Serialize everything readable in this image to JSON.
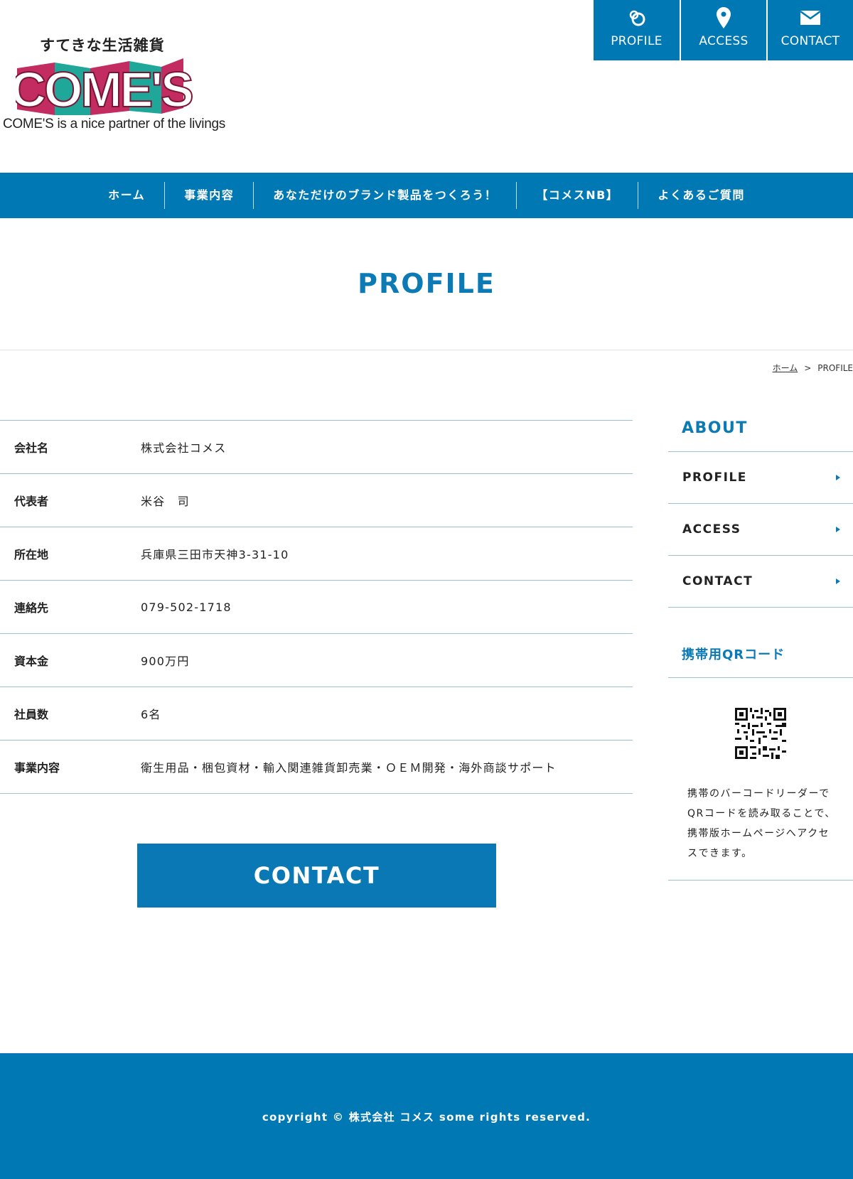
{
  "logo": {
    "tagline_jp": "すてきな生活雑貨",
    "brand": "COME'S",
    "subtitle": "COME'S is a nice partner of the livings"
  },
  "top_nav": [
    {
      "label": "PROFILE",
      "icon": "link-rings-icon"
    },
    {
      "label": "ACCESS",
      "icon": "map-pin-icon"
    },
    {
      "label": "CONTACT",
      "icon": "envelope-icon"
    }
  ],
  "main_nav": [
    "ホーム",
    "事業内容",
    "あなただけのブランド製品をつくろう！",
    "【コメスNB】",
    "よくあるご質問"
  ],
  "page": {
    "title": "PROFILE"
  },
  "breadcrumb": {
    "home": "ホーム",
    "separator": ">",
    "current": "PROFILE"
  },
  "profile_rows": [
    {
      "label": "会社名",
      "value": "株式会社コメス"
    },
    {
      "label": "代表者",
      "value": "米谷　司"
    },
    {
      "label": "所在地",
      "value": "兵庫県三田市天神3-31-10"
    },
    {
      "label": "連絡先",
      "value": "079-502-1718"
    },
    {
      "label": "資本金",
      "value": "900万円"
    },
    {
      "label": "社員数",
      "value": "6名"
    },
    {
      "label": "事業内容",
      "value": "衛生用品・梱包資材・輸入関連雑貨卸売業・ＯＥＭ開発・海外商談サポート"
    }
  ],
  "contact_button": "CONTACT",
  "sidebar": {
    "heading": "ABOUT",
    "items": [
      "PROFILE",
      "ACCESS",
      "CONTACT"
    ],
    "qr_heading": "携帯用QRコード",
    "qr_text": "携帯のバーコードリーダーでQRコードを読み取ることで、携帯版ホームページへアクセスできます。"
  },
  "footer": {
    "copyright": "copyright © 株式会社 コメス some rights reserved."
  },
  "colors": {
    "primary": "#0078b4",
    "title": "#0b7ab5",
    "logo_magenta": "#c22c60",
    "logo_teal": "#1fa89a",
    "rule": "#9dc1d3"
  }
}
